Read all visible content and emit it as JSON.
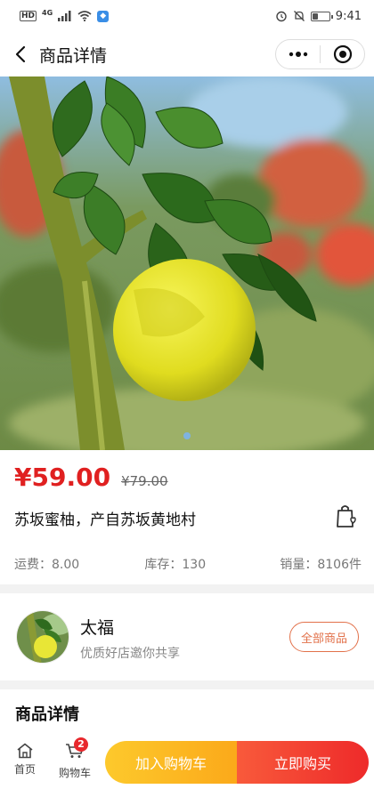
{
  "status_bar": {
    "hd": "HD",
    "network": "4G",
    "time": "9:41",
    "battery_level": 0.3,
    "icons": [
      "hd-badge",
      "4g-signal-icon",
      "signal-bars-icon",
      "wifi-icon",
      "app-icon",
      "alarm-icon",
      "mute-icon",
      "battery-icon"
    ]
  },
  "nav": {
    "title": "商品详情",
    "icons": [
      "back-arrow-icon",
      "more-dots-icon",
      "target-icon"
    ]
  },
  "product": {
    "image": "pomelo-photo",
    "carousel_dots": 1,
    "price": "¥59.00",
    "original_price": "¥79.00",
    "title": "苏坂蜜柚，产自苏坂黄地村",
    "stats": {
      "shipping": "运费：8.00",
      "stock": "库存：130",
      "sales": "销量：8106件"
    }
  },
  "shop": {
    "name": "太福",
    "slogan": "优质好店邀你共享",
    "all_goods_label": "全部商品"
  },
  "details": {
    "title": "商品详情"
  },
  "bottom_bar": {
    "home_label": "首页",
    "cart_label": "购物车",
    "cart_badge": "2",
    "add_to_cart_label": "加入购物车",
    "buy_now_label": "立即购买"
  },
  "colors": {
    "price_red": "#e02020",
    "accent_orange": "#e2714a",
    "add_cart_yellow": "#fdc92c",
    "buy_red": "#ee2a2a"
  }
}
